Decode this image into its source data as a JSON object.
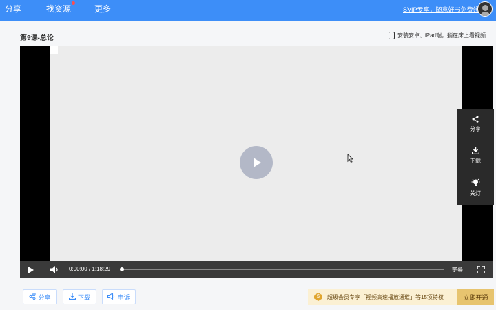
{
  "nav": {
    "share": "分享",
    "find_resource": "找资源",
    "more": "更多",
    "svip_promo": "SVIP专享，随意好书免费领"
  },
  "lesson": {
    "title": "第9课-总论",
    "ipad_hint": "安装安卓、iPad端，躺在床上看视频"
  },
  "player": {
    "current_time": "0:00:00",
    "separator": "/",
    "duration": "1:18:29",
    "progress": 0,
    "subtitle_label": "字幕",
    "side": {
      "share": "分享",
      "download": "下载",
      "light_off": "关灯"
    }
  },
  "actions": {
    "share": "分享",
    "download": "下载",
    "report": "申诉"
  },
  "promo": {
    "badge": "$",
    "text": "超级会员专享「视频高速播放通道」等15项特权",
    "button": "立即开通"
  },
  "icons": {
    "share": "share-icon",
    "download": "download-icon",
    "lightbulb": "lightbulb-icon",
    "megaphone": "megaphone-icon",
    "volume": "volume-icon",
    "fullscreen": "fullscreen-icon"
  },
  "colors": {
    "brand": "#3d8ef8",
    "promo_bg": "#fbf0d3",
    "promo_button": "#e7c46f"
  }
}
